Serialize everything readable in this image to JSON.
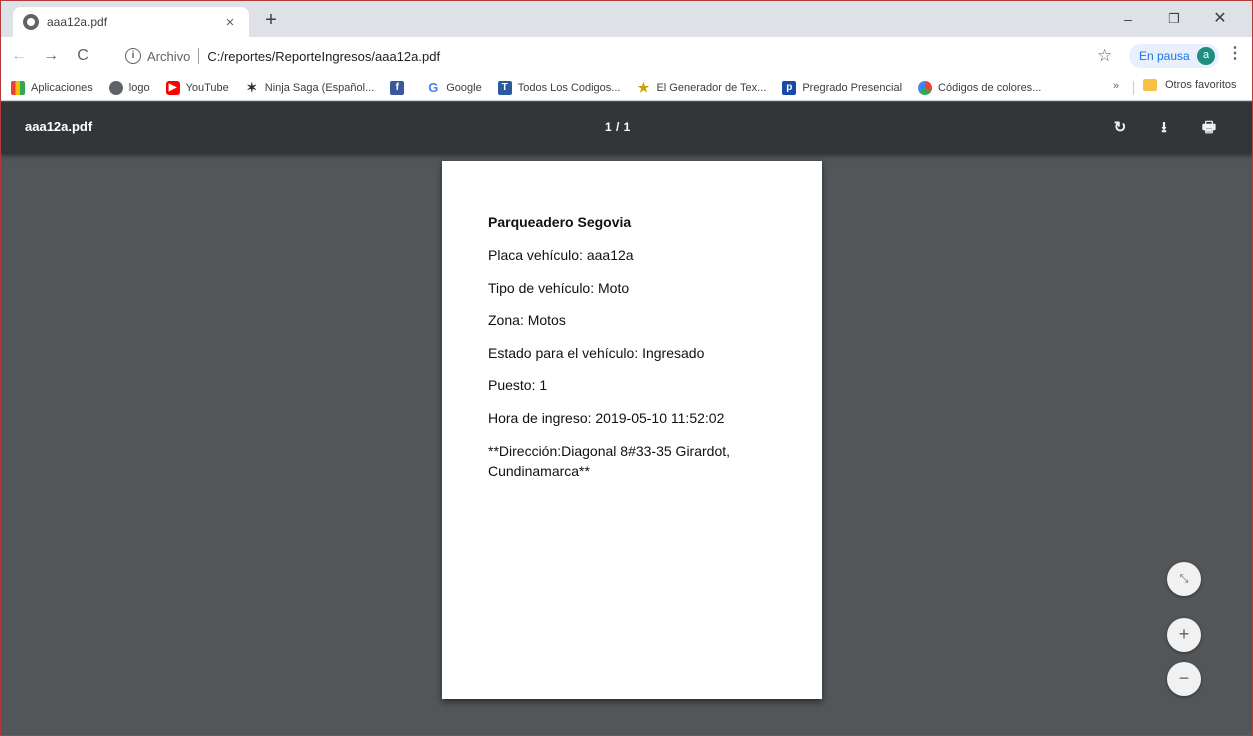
{
  "tab": {
    "title": "aaa12a.pdf",
    "close": "×",
    "new_tab": "+"
  },
  "window": {
    "minimize": "–",
    "maximize": "❐",
    "close": "✕"
  },
  "nav": {
    "back": "←",
    "forward": "→",
    "reload": "C"
  },
  "omnibox": {
    "info_icon": "i",
    "scheme": "Archivo",
    "url": "C:/reportes/ReporteIngresos/aaa12a.pdf"
  },
  "profile": {
    "star": "☆",
    "status": "En pausa",
    "avatar_letter": "a",
    "menu": "⋮"
  },
  "bookmarks": {
    "items": [
      {
        "label": "Aplicaciones",
        "icon": "apps-grid-icon",
        "glyph": ""
      },
      {
        "label": "logo",
        "icon": "globe-icon",
        "glyph": ""
      },
      {
        "label": "YouTube",
        "icon": "youtube-icon",
        "glyph": "▶"
      },
      {
        "label": "Ninja Saga (Español...",
        "icon": "ninja-icon",
        "glyph": "✶"
      },
      {
        "label": "",
        "icon": "facebook-icon",
        "glyph": "f"
      },
      {
        "label": "Google",
        "icon": "google-icon",
        "glyph": "G"
      },
      {
        "label": "Todos Los Codigos...",
        "icon": "tl-icon",
        "glyph": "T"
      },
      {
        "label": "El Generador de Tex...",
        "icon": "star-bookmark-icon",
        "glyph": "★"
      },
      {
        "label": "Pregrado Presencial",
        "icon": "pregrado-icon",
        "glyph": "p"
      },
      {
        "label": "Códigos de colores...",
        "icon": "color-wheel-icon",
        "glyph": ""
      }
    ],
    "more": "»",
    "other": "Otros favoritos"
  },
  "pdf_viewer": {
    "file_name": "aaa12a.pdf",
    "page_indicator": "1 / 1",
    "rotate_icon": "↻",
    "download_icon": "⭳",
    "print_icon": "🖶",
    "fit_icon": "⤡",
    "zoom_in": "+",
    "zoom_out": "−"
  },
  "document": {
    "heading": "Parqueadero Segovia",
    "lines": [
      "Placa vehículo: aaa12a",
      "Tipo de vehículo: Moto",
      "Zona: Motos",
      "Estado para el vehículo: Ingresado",
      "Puesto: 1",
      "Hora de ingreso: 2019-05-10 11:52:02"
    ],
    "address_line1": "**Dirección:Diagonal 8#33-35 Girardot,",
    "address_line2": "Cundinamarca**"
  },
  "colors": {
    "pdf_background": "#525659",
    "pdf_toolbar": "#323639",
    "window_border": "#b23a3a"
  }
}
